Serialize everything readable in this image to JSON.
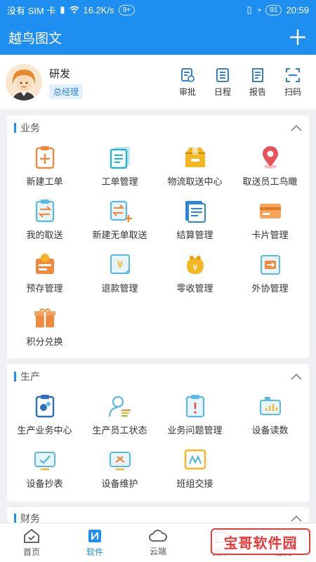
{
  "status_bar": {
    "carrier": "没有 SIM 卡",
    "speed": "16.2K/s",
    "badge": "9+",
    "battery": "91",
    "time": "20:59"
  },
  "header": {
    "title": "越鸟图文"
  },
  "profile": {
    "name": "研发",
    "role": "总经理",
    "actions": [
      {
        "label": "审批",
        "icon": "approve-icon"
      },
      {
        "label": "日程",
        "icon": "schedule-icon"
      },
      {
        "label": "报告",
        "icon": "report-icon"
      },
      {
        "label": "扫码",
        "icon": "scan-icon"
      }
    ]
  },
  "sections": [
    {
      "title": "业务",
      "items": [
        {
          "label": "新建工单",
          "icon": "new-order-icon"
        },
        {
          "label": "工单管理",
          "icon": "order-manage-icon"
        },
        {
          "label": "物流取送中心",
          "icon": "logistics-icon"
        },
        {
          "label": "取送员工鸟瞰",
          "icon": "location-pin-icon"
        },
        {
          "label": "我的取送",
          "icon": "my-delivery-icon"
        },
        {
          "label": "新建无单取送",
          "icon": "new-delivery-icon"
        },
        {
          "label": "结算管理",
          "icon": "settlement-icon"
        },
        {
          "label": "卡片管理",
          "icon": "card-icon"
        },
        {
          "label": "预存管理",
          "icon": "prepaid-icon"
        },
        {
          "label": "退款管理",
          "icon": "refund-icon"
        },
        {
          "label": "零收管理",
          "icon": "purse-icon"
        },
        {
          "label": "外协管理",
          "icon": "outsource-icon"
        },
        {
          "label": "积分兑换",
          "icon": "gift-icon"
        }
      ]
    },
    {
      "title": "生产",
      "items": [
        {
          "label": "生产业务中心",
          "icon": "production-icon"
        },
        {
          "label": "生产员工状态",
          "icon": "staff-status-icon"
        },
        {
          "label": "业务问题管理",
          "icon": "issue-icon"
        },
        {
          "label": "设备读数",
          "icon": "device-reading-icon"
        },
        {
          "label": "设备抄表",
          "icon": "meter-icon"
        },
        {
          "label": "设备维护",
          "icon": "maintenance-icon"
        },
        {
          "label": "班组交接",
          "icon": "handover-icon"
        }
      ]
    },
    {
      "title": "财务",
      "items": []
    }
  ],
  "bottom_nav": [
    {
      "label": "首页",
      "icon": "home-icon"
    },
    {
      "label": "软件",
      "icon": "software-icon"
    },
    {
      "label": "云端",
      "icon": "cloud-icon"
    },
    {
      "label": "集市",
      "icon": "market-icon"
    },
    {
      "label": "服务",
      "icon": "service-icon"
    }
  ],
  "watermark": "宝哥软件园",
  "colors": {
    "brand": "#1e8ef0",
    "orange": "#f08a3c",
    "teal": "#27b3c7",
    "red": "#e8505b",
    "yellow": "#f5b623"
  }
}
